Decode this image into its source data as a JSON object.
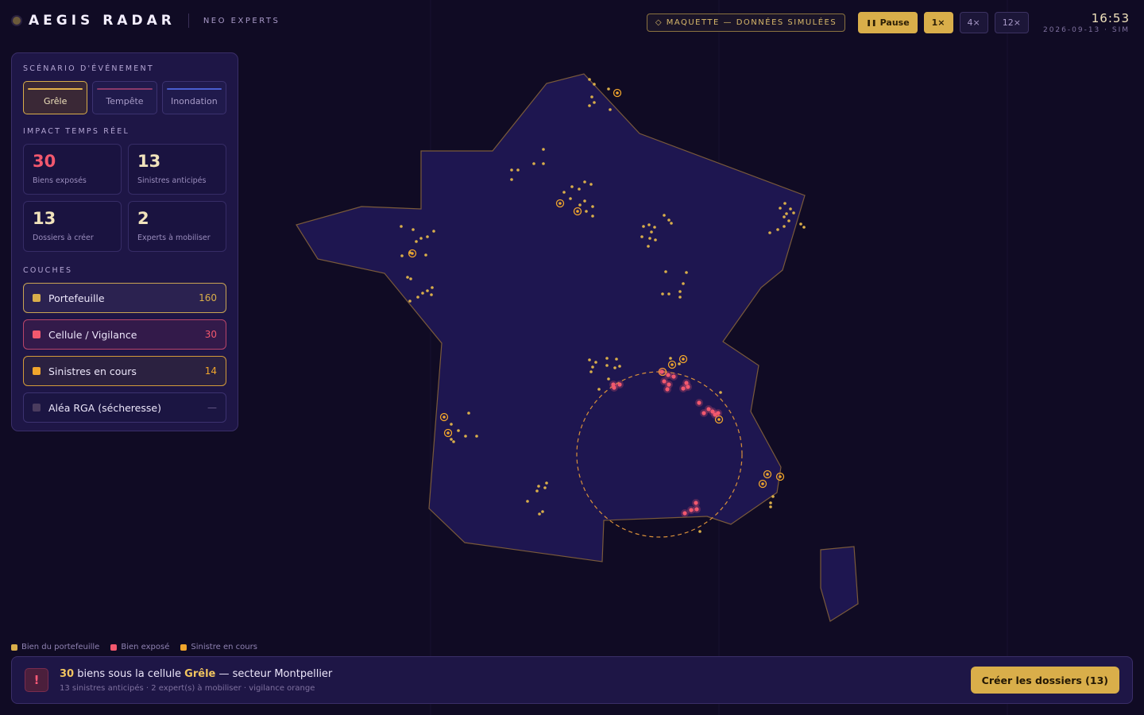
{
  "header": {
    "brand_title": "AEGIS RADAR",
    "brand_subtitle": "NEO EXPERTS",
    "mock_badge": "◇ MAQUETTE — DONNÉES SIMULÉES",
    "controls": {
      "pause_label": "Pause",
      "speeds": [
        "1×",
        "4×",
        "12×"
      ],
      "active_speed": "1×"
    },
    "clock": {
      "time": "16:53",
      "date": "2026-09-13 · SIM"
    }
  },
  "panel": {
    "scenario_title": "SCÉNARIO D'ÉVÉNEMENT",
    "scenarios": [
      {
        "label": "Grêle",
        "color": "#e3b04a",
        "active": true
      },
      {
        "label": "Tempête",
        "color": "#8a3a6a",
        "active": false
      },
      {
        "label": "Inondation",
        "color": "#4a5fd0",
        "active": false
      }
    ],
    "impact_title": "IMPACT TEMPS RÉEL",
    "kpis": [
      {
        "value": "30",
        "label": "Biens exposés",
        "color": "#f2586e"
      },
      {
        "value": "13",
        "label": "Sinistres anticipés",
        "color": "#f1e3bc"
      },
      {
        "value": "13",
        "label": "Dossiers à créer",
        "color": "#f1e3bc"
      },
      {
        "value": "2",
        "label": "Experts à mobiliser",
        "color": "#f1e3bc"
      }
    ],
    "layers_title": "COUCHES",
    "layers": [
      {
        "label": "Portefeuille",
        "count": "160",
        "color": "#d9ae4a"
      },
      {
        "label": "Cellule / Vigilance",
        "count": "30",
        "color": "#f2586e"
      },
      {
        "label": "Sinistres en cours",
        "count": "14",
        "color": "#f0a52c"
      },
      {
        "label": "Aléa RGA (sécheresse)",
        "count": "—",
        "color": "#4a3c5e"
      }
    ]
  },
  "legend": [
    {
      "label": "Bien du portefeuille",
      "color": "#d9ae4a"
    },
    {
      "label": "Bien exposé",
      "color": "#f2586e"
    },
    {
      "label": "Sinistre en cours",
      "color": "#f0a52c"
    }
  ],
  "alert": {
    "icon": "!",
    "count": "30",
    "title_middle": " biens sous la cellule ",
    "event": "Grêle",
    "title_end": " — secteur Montpellier",
    "subtitle": "13 sinistres anticipés · 2 expert(s) à mobiliser · vigilance orange",
    "cta": "Créer les dossiers (13)"
  },
  "colors": {
    "background": "#100b24",
    "accent": "#d9ae4a",
    "danger": "#f2586e",
    "map_fill": "#1e1650",
    "map_stroke": "#7a5a3a"
  }
}
